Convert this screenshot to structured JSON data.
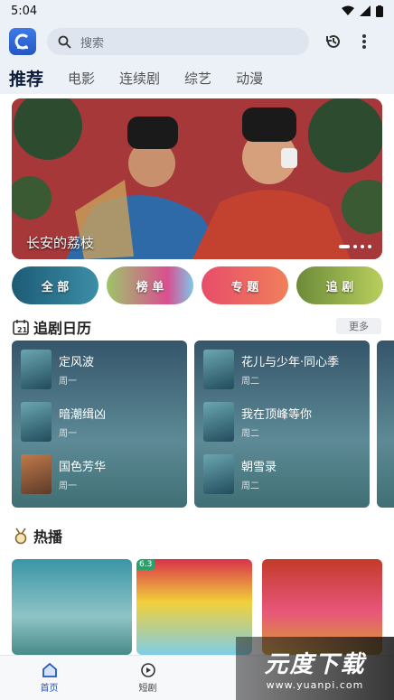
{
  "status": {
    "time": "5:04"
  },
  "search": {
    "placeholder": "搜索"
  },
  "tabs": [
    {
      "label": "推荐",
      "active": true
    },
    {
      "label": "电影"
    },
    {
      "label": "连续剧"
    },
    {
      "label": "综艺"
    },
    {
      "label": "动漫"
    }
  ],
  "banner": {
    "title": "长安的荔枝"
  },
  "quick": [
    {
      "label": "全 部"
    },
    {
      "label": "榜 单"
    },
    {
      "label": "专 题"
    },
    {
      "label": "追 剧"
    }
  ],
  "calendar": {
    "title": "追剧日历",
    "more": "更多",
    "columns": [
      {
        "items": [
          {
            "title": "定风波",
            "day": "周一"
          },
          {
            "title": "暗潮缉凶",
            "day": "周一"
          },
          {
            "title": "国色芳华",
            "day": "周一"
          }
        ]
      },
      {
        "items": [
          {
            "title": "花儿与少年·同心季",
            "day": "周二"
          },
          {
            "title": "我在顶峰等你",
            "day": "周二"
          },
          {
            "title": "朝雪录",
            "day": "周二"
          }
        ]
      }
    ]
  },
  "hot": {
    "title": "热播",
    "items": [
      {
        "score": ""
      },
      {
        "score": "6.3"
      },
      {
        "score": ""
      }
    ]
  },
  "bottom_nav": [
    {
      "label": "首页",
      "icon": "home-icon",
      "active": true
    },
    {
      "label": "短剧",
      "icon": "play-circle-icon"
    },
    {
      "label": "",
      "icon": ""
    },
    {
      "label": "",
      "icon": ""
    }
  ],
  "watermark": {
    "line1": "元度下载",
    "line2": "www.yuanpi.com"
  },
  "colors": {
    "accent": "#1f56c8",
    "header_bg": "#ecf1f8",
    "banner_bg": "#9b2c2f"
  }
}
